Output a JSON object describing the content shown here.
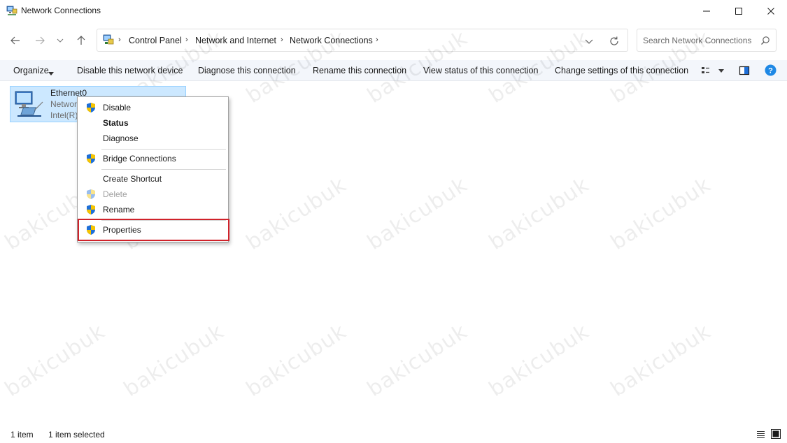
{
  "window": {
    "title": "Network Connections",
    "controls": {
      "minimize": "minimize",
      "maximize": "maximize",
      "close": "close"
    }
  },
  "address": {
    "breadcrumbs": [
      "Control Panel",
      "Network and Internet",
      "Network Connections"
    ]
  },
  "search": {
    "placeholder": "Search Network Connections",
    "value": ""
  },
  "commandbar": {
    "organize": "Organize",
    "disable": "Disable this network device",
    "diagnose": "Diagnose this connection",
    "rename": "Rename this connection",
    "view_status": "View status of this connection",
    "change_settings": "Change settings of this connection"
  },
  "connection": {
    "name": "Ethernet0",
    "type_visible": "Networ",
    "device_visible": "Intel(R)",
    "icon": "network-adapter-icon"
  },
  "context_menu": {
    "items": [
      {
        "label": "Disable",
        "shield": true,
        "bold": false,
        "disabled": false
      },
      {
        "label": "Status",
        "shield": false,
        "bold": true,
        "disabled": false
      },
      {
        "label": "Diagnose",
        "shield": false,
        "bold": false,
        "disabled": false
      },
      {
        "label": "Bridge Connections",
        "shield": true,
        "bold": false,
        "disabled": false
      },
      {
        "label": "Create Shortcut",
        "shield": false,
        "bold": false,
        "disabled": false
      },
      {
        "label": "Delete",
        "shield": true,
        "bold": false,
        "disabled": true
      },
      {
        "label": "Rename",
        "shield": true,
        "bold": false,
        "disabled": false
      },
      {
        "label": "Properties",
        "shield": true,
        "bold": false,
        "disabled": false
      }
    ],
    "highlighted": "Properties",
    "highlight_color": "#d0222a"
  },
  "statusbar": {
    "count": "1 item",
    "selected": "1 item selected"
  },
  "watermark": "bakicubuk",
  "colors": {
    "selection_bg": "#cce8ff",
    "selection_border": "#99d1ff",
    "command_bar_bg": "#f3f6fb"
  }
}
